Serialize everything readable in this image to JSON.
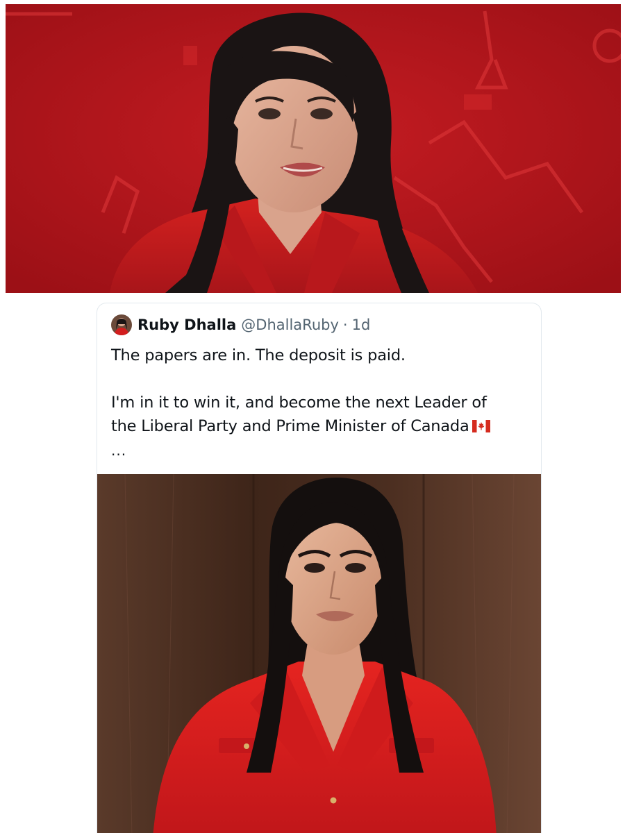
{
  "top_image": {
    "alt_icon": "portrait-photo"
  },
  "tweet": {
    "author_name": "Ruby Dhalla",
    "handle": "@DhallaRuby",
    "separator": "·",
    "time": "1d",
    "line1": "The papers are in. The deposit is paid.",
    "line2a": "I'm in it to win it, and become the next Leader of",
    "line2b": "the Liberal Party and Prime Minister of Canada",
    "flag_icon": "canada-flag-icon",
    "more": "...",
    "media_icon": "portrait-photo"
  },
  "colors": {
    "backdrop_red": "#b5151b",
    "jacket_red": "#d21e1e",
    "text_primary": "#0f1419",
    "text_secondary": "#536471",
    "card_border": "#e1e8ed",
    "wood_brown": "#4a2f22"
  }
}
